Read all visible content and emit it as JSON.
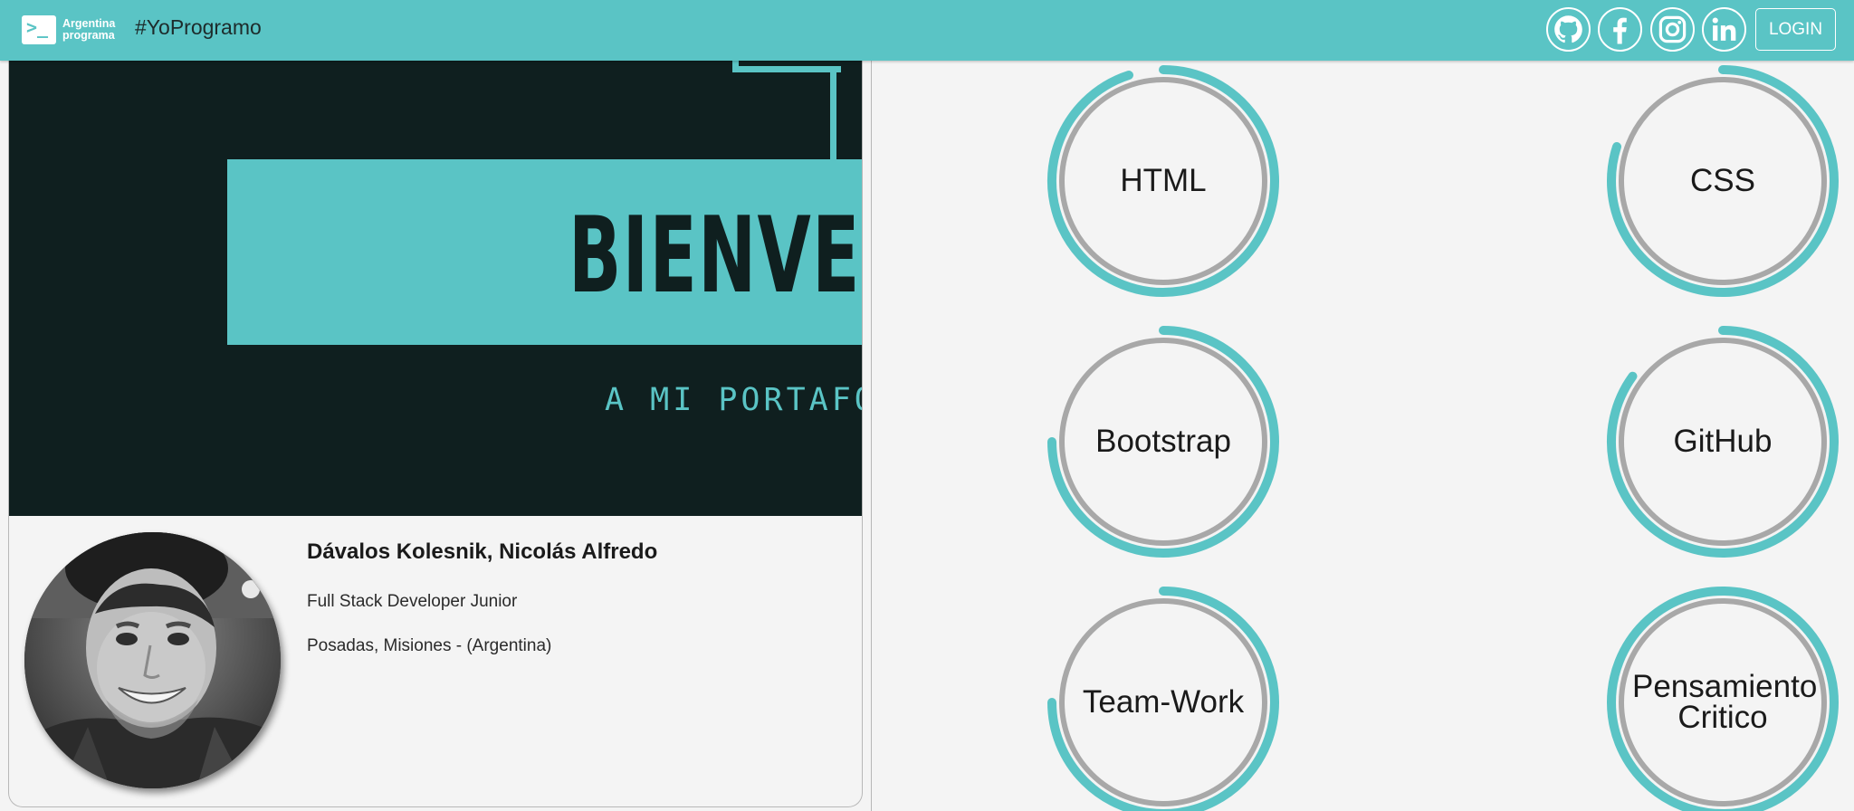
{
  "navbar": {
    "logo_line1": "Argentina",
    "logo_line2": "programa",
    "hashtag": "#YoProgramo",
    "social": [
      "github-icon",
      "facebook-icon",
      "instagram-icon",
      "linkedin-icon"
    ],
    "login_label": "LOGIN"
  },
  "banner": {
    "title": "BIENVENIDO",
    "subtitle": "A MI PORTAFOLIO"
  },
  "profile": {
    "name": "Dávalos Kolesnik, Nicolás Alfredo",
    "role": "Full Stack Developer Junior",
    "location": "Posadas, Misiones - (Argentina)"
  },
  "skills": [
    {
      "label": "HTML",
      "percent": 95
    },
    {
      "label": "CSS",
      "percent": 80
    },
    {
      "label": "Bootstrap",
      "percent": 75
    },
    {
      "label": "GitHub",
      "percent": 85
    },
    {
      "label": "Team-Work",
      "percent": 75
    },
    {
      "label": "Pensamiento Critico",
      "percent": 100
    }
  ],
  "colors": {
    "accent": "#5ac4c5",
    "banner_bg": "#0f1f1f",
    "skill_track": "#a8a8a8",
    "page_bg": "#f4f4f4"
  }
}
